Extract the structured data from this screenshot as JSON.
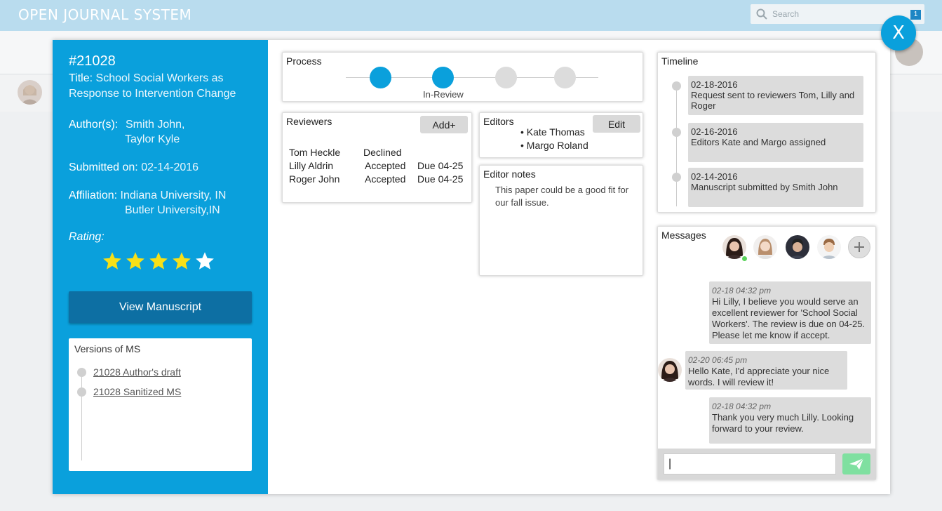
{
  "app": {
    "title": "OPEN JOURNAL SYSTEM"
  },
  "search": {
    "placeholder": "Search",
    "notification_count": "1"
  },
  "manuscript": {
    "id": "#21028",
    "title_label": "Title:",
    "title_value": "School Social Workers as Response to Intervention Change",
    "authors_label": "Author(s):",
    "authors": [
      "Smith John,",
      "Taylor Kyle"
    ],
    "submitted_label": "Submitted on:",
    "submitted_value": "02-14-2016",
    "affiliation_label": "Affiliation:",
    "affiliations": [
      "Indiana University, IN",
      "Butler University,IN"
    ],
    "rating_label": "Rating:",
    "rating": {
      "value": 4,
      "max": 5
    },
    "view_button": "View Manuscript",
    "versions_title": "Versions of MS",
    "versions": [
      "21028 Author's draft",
      "21028  Sanitized MS"
    ]
  },
  "process": {
    "title": "Process",
    "current_step_label": "In-Review",
    "steps_total": 4,
    "steps_completed": 2
  },
  "reviewers": {
    "title": "Reviewers",
    "add_button": "Add+",
    "rows": [
      {
        "name": "Tom Heckle",
        "status": "Declined",
        "due": ""
      },
      {
        "name": "Lilly Aldrin",
        "status": "Accepted",
        "due": "Due 04-25"
      },
      {
        "name": "Roger John",
        "status": "Accepted",
        "due": "Due 04-25"
      }
    ]
  },
  "editors": {
    "title": "Editors",
    "edit_button": "Edit",
    "names": [
      "Kate Thomas",
      "Margo Roland"
    ]
  },
  "editor_notes": {
    "title": "Editor notes",
    "text": "This paper could be a good fit for our fall issue."
  },
  "timeline": {
    "title": "Timeline",
    "events": [
      {
        "date": "02-18-2016",
        "text": "Request sent to reviewers Tom, Lilly and Roger"
      },
      {
        "date": "02-16-2016",
        "text": "Editors Kate and Margo assigned"
      },
      {
        "date": "02-14-2016",
        "text": "Manuscript submitted by Smith John"
      }
    ]
  },
  "messages": {
    "title": "Messages",
    "items": [
      {
        "time": "02-18  04:32 pm",
        "text": "Hi Lilly, I believe you would serve an excellent reviewer for 'School Social Workers'. The review is due on 04-25. Please let me know if accept."
      },
      {
        "time": "02-20  06:45 pm",
        "text": "Hello Kate, I'd appreciate your nice words. I will review it!"
      },
      {
        "time": "02-18  04:32 pm",
        "text": "Thank you very much Lilly. Looking forward to your review."
      }
    ],
    "input_value": "|"
  },
  "close_button": "X",
  "colors": {
    "accent": "#0aa0dc",
    "button_dark": "#0d6fa3",
    "star": "#f7e017",
    "send": "#7fe0a0"
  },
  "icons": [
    "search-icon",
    "star-icon",
    "plus-icon",
    "send-icon",
    "close-icon"
  ]
}
